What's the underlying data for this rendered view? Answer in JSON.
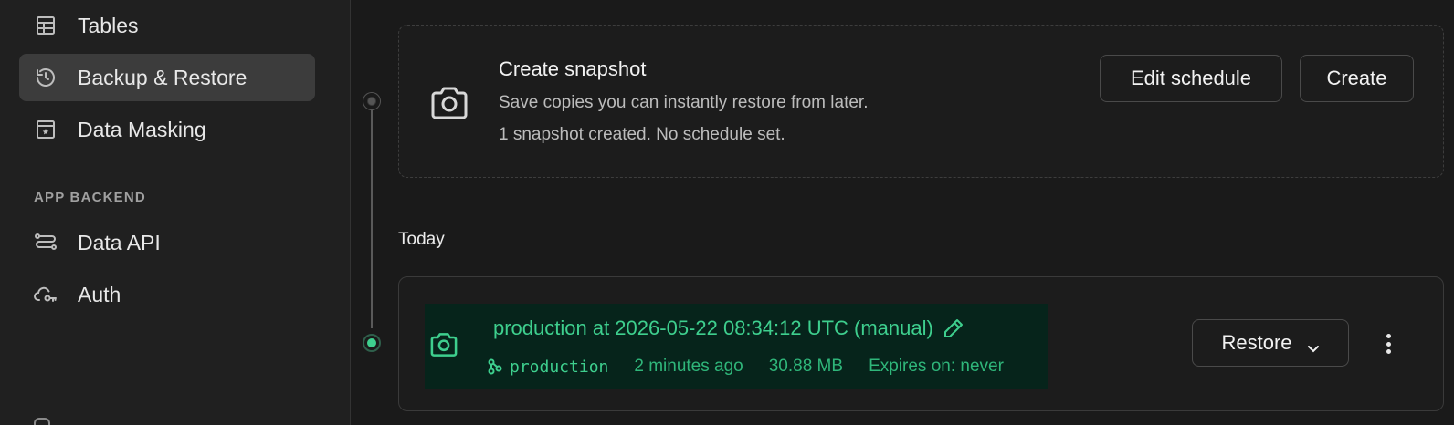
{
  "sidebar": {
    "items": [
      {
        "label": "Tables",
        "icon": "table-icon"
      },
      {
        "label": "Backup & Restore",
        "icon": "history-icon",
        "active": true
      },
      {
        "label": "Data Masking",
        "icon": "masking-icon"
      }
    ],
    "section_label": "APP BACKEND",
    "backend_items": [
      {
        "label": "Data API",
        "icon": "api-icon"
      },
      {
        "label": "Auth",
        "icon": "auth-icon"
      }
    ]
  },
  "snapshot": {
    "title": "Create snapshot",
    "description": "Save copies you can instantly restore from later.",
    "status": "1 snapshot created. No schedule set.",
    "edit_schedule_label": "Edit schedule",
    "create_label": "Create"
  },
  "group_label": "Today",
  "backup": {
    "title": "production at 2026-05-22 08:34:12 UTC (manual)",
    "branch": "production",
    "age": "2 minutes ago",
    "size": "30.88 MB",
    "expires": "Expires on: never",
    "restore_label": "Restore"
  },
  "colors": {
    "accent": "#3ecf8e",
    "highlight_bg": "#06241b",
    "sidebar_bg": "#202020",
    "main_bg": "#1a1a1a",
    "active_item_bg": "#3c3c3c"
  }
}
